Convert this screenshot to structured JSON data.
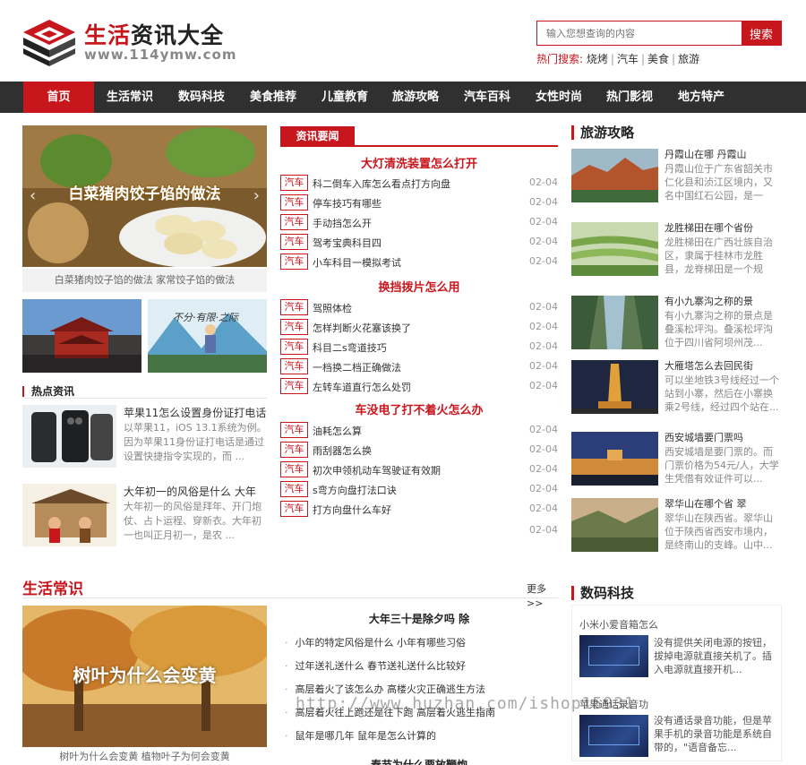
{
  "header": {
    "site_name_red": "生活",
    "site_name_dark": "资讯大全",
    "site_url": "www.114ymw.com",
    "search_placeholder": "输入您想查询的内容",
    "search_button": "搜索",
    "hot_label": "热门搜索:",
    "hot_items": [
      "烧烤",
      "汽车",
      "美食",
      "旅游"
    ]
  },
  "nav": {
    "items": [
      "首页",
      "生活常识",
      "数码科技",
      "美食推荐",
      "儿童教育",
      "旅游攻略",
      "汽车百科",
      "女性时尚",
      "热门影视",
      "地方特产"
    ],
    "active_index": 0
  },
  "slider": {
    "image_text": "白菜猪肉饺子馅的做法",
    "caption": "白菜猪肉饺子馅的做法 家常饺子馅的做法",
    "arrow_left": "‹",
    "arrow_right": "›",
    "thumb2_text": "不分·有限·之际"
  },
  "hot_news": {
    "title": "热点资讯",
    "items": [
      {
        "title": "苹果11怎么设置身份证打电话",
        "desc": "以苹果11，iOS 13.1系统为例。因为苹果11身份证打电话是通过设置快捷指令实现的，而 ..."
      },
      {
        "title": "大年初一的风俗是什么 大年",
        "desc": "大年初一的风俗是拜年、开门炮仗、占卜运程、穿新衣。大年初一也叫正月初一，是农 ..."
      }
    ]
  },
  "mid_news": {
    "tab": "资讯要闻",
    "groups": [
      {
        "head": "大灯清洗装置怎么打开",
        "rows": [
          {
            "tag": "汽车",
            "title": "科二倒车入库怎么看点打方向盘",
            "date": "02-04"
          },
          {
            "tag": "汽车",
            "title": "停车技巧有哪些",
            "date": "02-04"
          },
          {
            "tag": "汽车",
            "title": "手动挡怎么开",
            "date": "02-04"
          },
          {
            "tag": "汽车",
            "title": "驾考宝典科目四",
            "date": "02-04"
          },
          {
            "tag": "汽车",
            "title": "小车科目一模拟考试",
            "date": "02-04"
          }
        ]
      },
      {
        "head": "换挡拨片怎么用",
        "rows": [
          {
            "tag": "汽车",
            "title": "驾照体检",
            "date": "02-04"
          },
          {
            "tag": "汽车",
            "title": "怎样判断火花塞该换了",
            "date": "02-04"
          },
          {
            "tag": "汽车",
            "title": "科目二s弯道技巧",
            "date": "02-04"
          },
          {
            "tag": "汽车",
            "title": "一档换二档正确做法",
            "date": "02-04"
          },
          {
            "tag": "汽车",
            "title": "左转车道直行怎么处罚",
            "date": "02-04"
          }
        ]
      },
      {
        "head": "车没电了打不着火怎么办",
        "rows": [
          {
            "tag": "汽车",
            "title": "油耗怎么算",
            "date": "02-04"
          },
          {
            "tag": "汽车",
            "title": "雨刮器怎么换",
            "date": "02-04"
          },
          {
            "tag": "汽车",
            "title": "初次申领机动车驾驶证有效期",
            "date": "02-04"
          },
          {
            "tag": "汽车",
            "title": "s弯方向盘打法口诀",
            "date": "02-04"
          },
          {
            "tag": "汽车",
            "title": "打方向盘什么车好",
            "date": "02-04"
          }
        ]
      }
    ],
    "extra_date": "02-04"
  },
  "travel": {
    "title": "旅游攻略",
    "items": [
      {
        "title": "丹霞山在哪 丹霞山",
        "desc": "丹霞山位于广东省韶关市仁化县和浈江区境内，又名中国红石公园，是一处..."
      },
      {
        "title": "龙胜梯田在哪个省份",
        "desc": "龙胜梯田在广西壮族自治区，隶属于桂林市龙胜县，龙脊梯田是一个规模..."
      },
      {
        "title": "有小九寨沟之称的景",
        "desc": "有小九寨沟之称的景点是叠溪松坪沟。叠溪松坪沟位于四川省阿坝州茂..."
      },
      {
        "title": "大雁塔怎么去回民街",
        "desc": "可以坐地铁3号线经过一个站到小寨，然后在小寨换乘2号线，经过四个站在..."
      },
      {
        "title": "西安城墙要门票吗",
        "desc": "西安城墙是要门票的。而门票价格为54元/人，大学生凭借有效证件可以..."
      },
      {
        "title": "翠华山在哪个省 翠",
        "desc": "翠华山在陕西省。翠华山位于陕西省西安市境内，是终南山的支峰。山中..."
      }
    ]
  },
  "life": {
    "title": "生活常识",
    "more": "更多",
    "more_arrow": ">>",
    "image_text": "树叶为什么会变黄",
    "caption": "树叶为什么会变黄 植物叶子为何会变黄",
    "head": "大年三十是除夕吗 除",
    "items": [
      "小年的特定风俗是什么 小年有哪些习俗",
      "过年送礼送什么 春节送礼送什么比较好",
      "高层着火了该怎么办 高楼火灾正确逃生方法",
      "高层着火往上跑还是往下跑 高层着火逃生指南",
      "鼠年是哪几年 鼠年是怎么计算的"
    ],
    "next_head": "春节为什么要放鞭炮"
  },
  "digital": {
    "title": "数码科技",
    "items": [
      {
        "title": "小米小爱音箱怎么",
        "desc": "没有提供关闭电源的按钮，拔掉电源就直接关机了。插入电源就直接开机..."
      },
      {
        "title": "苹果通话录音功",
        "desc": "没有通话录音功能，但是苹果手机的录音功能是系统自带的，\"语音备忘..."
      }
    ]
  },
  "watermark": "http://www.huzhan.com/ishop15931"
}
